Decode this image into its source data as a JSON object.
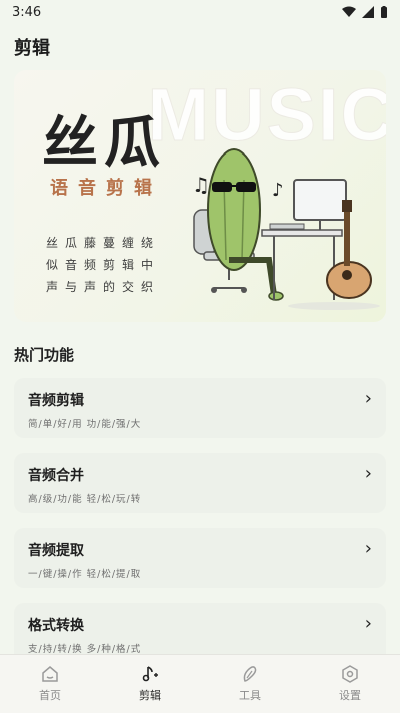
{
  "status_bar": {
    "time": "3:46"
  },
  "header": {
    "title": "剪辑"
  },
  "banner": {
    "watermark": "MUSIC",
    "big_title": "丝瓜",
    "sub_title": "语音剪辑",
    "slogan_lines": [
      "丝瓜藤蔓缠绕",
      "似音频剪辑中",
      "声与声的交织"
    ]
  },
  "section": {
    "title": "热门功能"
  },
  "features": [
    {
      "title": "音频剪辑",
      "desc": "简/单/好/用 功/能/强/大"
    },
    {
      "title": "音频合并",
      "desc": "高/级/功/能 轻/松/玩/转"
    },
    {
      "title": "音频提取",
      "desc": "一/键/操/作 轻/松/提/取"
    },
    {
      "title": "格式转换",
      "desc": "支/持/转/换 多/种/格/式"
    }
  ],
  "bottom_nav": [
    {
      "label": "首页",
      "icon": "home-icon"
    },
    {
      "label": "剪辑",
      "icon": "music-note-icon",
      "active": true
    },
    {
      "label": "工具",
      "icon": "tool-icon"
    },
    {
      "label": "设置",
      "icon": "settings-icon"
    }
  ]
}
